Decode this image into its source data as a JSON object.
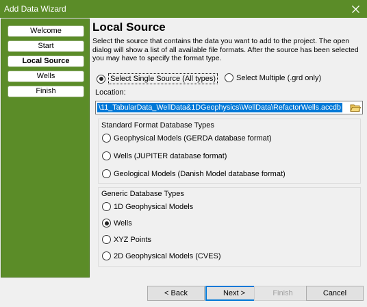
{
  "window": {
    "title": "Add Data Wizard"
  },
  "steps": [
    {
      "label": "Welcome"
    },
    {
      "label": "Start"
    },
    {
      "label": "Local Source"
    },
    {
      "label": "Wells"
    },
    {
      "label": "Finish"
    }
  ],
  "active_step": "Local Source",
  "page": {
    "title": "Local Source",
    "description": "Select the source that contains the data you want to add to the project.  The open dialog will show a list of all available file formats. After the source has been selected you may have to specify the format type."
  },
  "source_mode": {
    "single_label": "Select Single Source (All types)",
    "multiple_label": "Select Multiple (.grd only)",
    "selected": "single"
  },
  "location": {
    "label": "Location:",
    "value": "\\11_TabularData_WellData&1DGeophysics\\WellData\\RefactorWells.accdb"
  },
  "standard_group": {
    "title": "Standard Format Database Types",
    "options": [
      {
        "label": "Geophysical Models (GERDA database format)",
        "checked": false
      },
      {
        "label": "Wells (JUPITER database format)",
        "checked": false
      },
      {
        "label": "Geological Models (Danish Model database format)",
        "checked": false
      }
    ]
  },
  "generic_group": {
    "title": "Generic Database Types",
    "options": [
      {
        "label": "1D Geophysical Models",
        "checked": false
      },
      {
        "label": "Wells",
        "checked": true
      },
      {
        "label": "XYZ Points",
        "checked": false
      },
      {
        "label": "2D Geophysical Models (CVES)",
        "checked": false
      }
    ]
  },
  "buttons": {
    "back": "< Back",
    "next": "Next >",
    "finish": "Finish",
    "cancel": "Cancel"
  },
  "colors": {
    "accent": "#5b8c28",
    "selection": "#0078d7"
  },
  "icons": {
    "close": "close-icon",
    "folder": "folder-open-icon"
  }
}
